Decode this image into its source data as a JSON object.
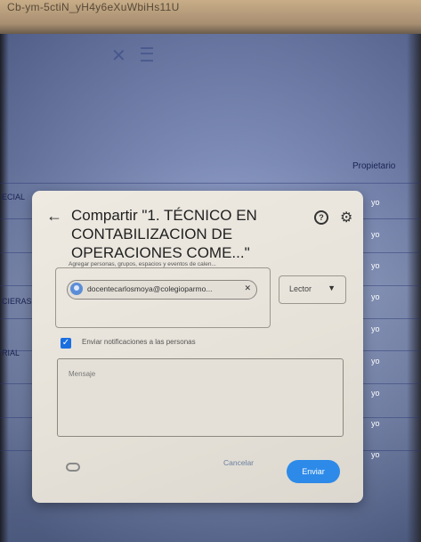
{
  "browser": {
    "url_fragment": "Cb-ym-5ctiN_yH4y6eXuWbiHs11U"
  },
  "background": {
    "owner_column_header": "Propietario",
    "row_labels": [
      "ECIAL",
      "CIERAS",
      "RIAL"
    ],
    "owner_cells": [
      "yo",
      "yo",
      "yo",
      "yo",
      "yo",
      "yo",
      "yo",
      "yo",
      "yo"
    ]
  },
  "dialog": {
    "title": "Compartir \"1. TÉCNICO EN CONTABILIZACION DE OPERACIONES COME...\"",
    "recipients_label": "Agregar personas, grupos, espacios y eventos de calen...",
    "chip_email": "docentecarlosmoya@colegioparmo...",
    "role": "Lector",
    "notify_label": "Enviar notificaciones a las personas",
    "notify_checked": true,
    "message_placeholder": "Mensaje",
    "cancel_label": "Cancelar",
    "send_label": "Enviar",
    "accent_color": "#1a73e8"
  },
  "icons": {
    "back": "arrow-left",
    "help": "help-circle",
    "settings": "gear",
    "link": "link",
    "remove": "close"
  }
}
